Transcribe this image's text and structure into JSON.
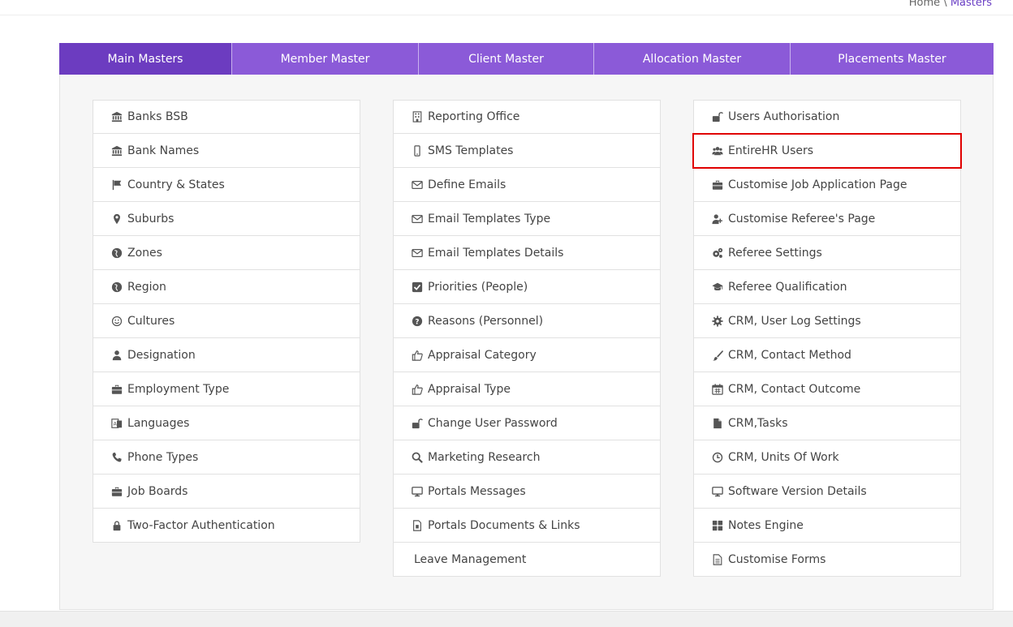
{
  "breadcrumb": {
    "home": "Home",
    "separator": "\\",
    "current": "Masters"
  },
  "tabs": [
    {
      "label": "Main Masters",
      "active": true
    },
    {
      "label": "Member Master",
      "active": false
    },
    {
      "label": "Client Master",
      "active": false
    },
    {
      "label": "Allocation Master",
      "active": false
    },
    {
      "label": "Placements Master",
      "active": false
    }
  ],
  "columns": {
    "left": [
      {
        "label": "Banks BSB",
        "icon": "bank-icon"
      },
      {
        "label": "Bank Names",
        "icon": "bank-icon"
      },
      {
        "label": "Country & States",
        "icon": "flag-icon"
      },
      {
        "label": "Suburbs",
        "icon": "map-marker-icon"
      },
      {
        "label": "Zones",
        "icon": "globe-icon"
      },
      {
        "label": "Region",
        "icon": "globe-icon"
      },
      {
        "label": "Cultures",
        "icon": "smile-icon"
      },
      {
        "label": "Designation",
        "icon": "user-icon"
      },
      {
        "label": "Employment Type",
        "icon": "briefcase-icon"
      },
      {
        "label": "Languages",
        "icon": "language-icon"
      },
      {
        "label": "Phone Types",
        "icon": "phone-icon"
      },
      {
        "label": "Job Boards",
        "icon": "briefcase-icon"
      },
      {
        "label": "Two-Factor Authentication",
        "icon": "lock-icon"
      }
    ],
    "middle": [
      {
        "label": "Reporting Office",
        "icon": "building-icon"
      },
      {
        "label": "SMS Templates",
        "icon": "mobile-icon"
      },
      {
        "label": "Define Emails",
        "icon": "envelope-icon"
      },
      {
        "label": "Email Templates Type",
        "icon": "envelope-icon"
      },
      {
        "label": "Email Templates Details",
        "icon": "envelope-icon"
      },
      {
        "label": "Priorities (People)",
        "icon": "check-square-icon"
      },
      {
        "label": "Reasons (Personnel)",
        "icon": "question-circle-icon"
      },
      {
        "label": "Appraisal Category",
        "icon": "thumbs-up-icon"
      },
      {
        "label": "Appraisal Type",
        "icon": "thumbs-up-icon"
      },
      {
        "label": "Change User Password",
        "icon": "unlock-icon"
      },
      {
        "label": "Marketing Research",
        "icon": "search-icon"
      },
      {
        "label": "Portals Messages",
        "icon": "desktop-icon"
      },
      {
        "label": "Portals Documents & Links",
        "icon": "file-document-icon"
      },
      {
        "label": "Leave Management",
        "icon": ""
      }
    ],
    "right": [
      {
        "label": "Users Authorisation",
        "icon": "unlock-icon"
      },
      {
        "label": "EntireHR Users",
        "icon": "users-icon",
        "highlighted": true
      },
      {
        "label": "Customise Job Application Page",
        "icon": "briefcase-icon"
      },
      {
        "label": "Customise Referee's Page",
        "icon": "user-plus-icon"
      },
      {
        "label": "Referee Settings",
        "icon": "cogs-icon"
      },
      {
        "label": "Referee Qualification",
        "icon": "graduation-cap-icon"
      },
      {
        "label": "CRM, User Log Settings",
        "icon": "gear-icon"
      },
      {
        "label": "CRM, Contact Method",
        "icon": "paint-brush-icon"
      },
      {
        "label": "CRM, Contact Outcome",
        "icon": "calendar-icon"
      },
      {
        "label": "CRM,Tasks",
        "icon": "file-icon"
      },
      {
        "label": "CRM, Units Of Work",
        "icon": "clock-icon"
      },
      {
        "label": "Software Version Details",
        "icon": "desktop-icon"
      },
      {
        "label": "Notes Engine",
        "icon": "th-large-icon"
      },
      {
        "label": "Customise Forms",
        "icon": "file-text-icon"
      }
    ]
  },
  "colors": {
    "tab_bg": "#8b5ad8",
    "tab_active_bg": "#6c3cc0",
    "highlight_border": "#e00000",
    "breadcrumb_active": "#6a3fc4"
  }
}
